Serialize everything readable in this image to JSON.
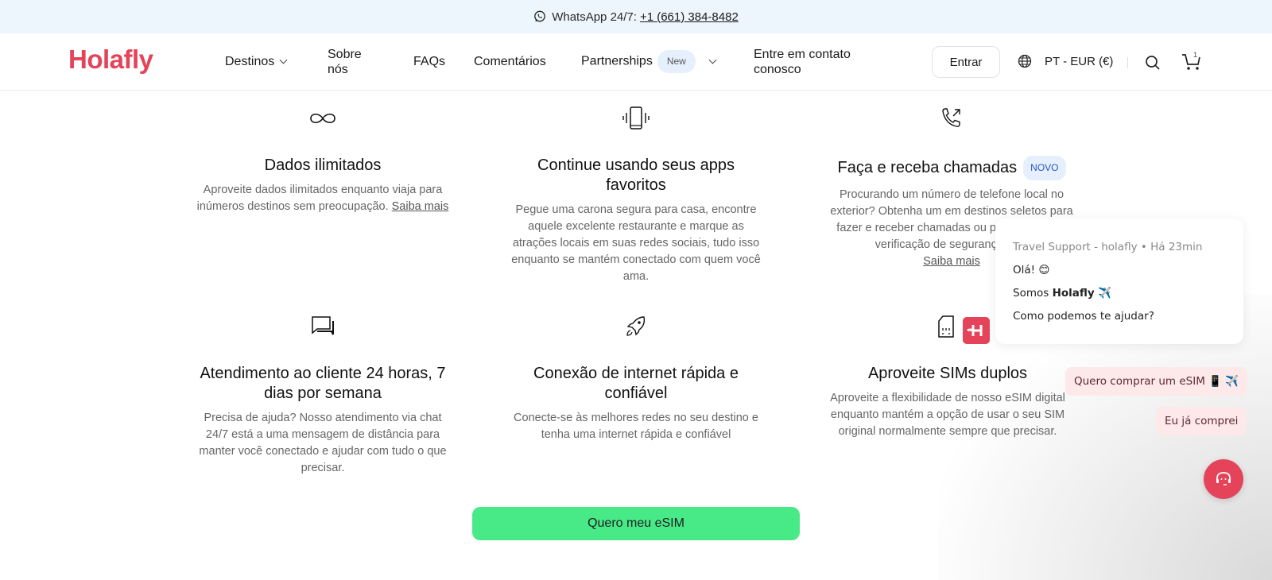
{
  "topbar": {
    "whatsapp_label": "WhatsApp 24/7:",
    "phone": "+1 (661) 384-8482",
    "icon": "whatsapp-icon"
  },
  "nav": {
    "logo": "Holafly",
    "items": [
      {
        "label": "Destinos",
        "has_dropdown": true
      },
      {
        "label": "Sobre nós"
      },
      {
        "label": "FAQs"
      },
      {
        "label": "Comentários"
      },
      {
        "label": "Partnerships",
        "badge": "New",
        "has_dropdown": true
      },
      {
        "label": "Entre em contato conosco"
      }
    ],
    "login_label": "Entrar",
    "locale_label": "PT - EUR (€)",
    "cart_count": "1",
    "brand_color": "#e5435a"
  },
  "features": [
    {
      "icon": "infinity-icon",
      "title": "Dados ilimitados",
      "text": "Aproveite dados ilimitados enquanto viaja para inúmeros destinos sem preocupação.",
      "link": "Saiba mais"
    },
    {
      "icon": "phone-vibrate-icon",
      "title": "Continue usando seus apps favoritos",
      "text": "Pegue uma carona segura para casa, encontre aquele excelente restaurante e marque as atrações locais em suas redes sociais, tudo isso enquanto se mantém conectado com quem você ama."
    },
    {
      "icon": "phone-call-icon",
      "title": "Faça e receba chamadas",
      "badge": "NOVO",
      "text": "Procurando um número de telefone local no exterior? Obtenha um em destinos seletos para fazer e receber chamadas ou para pontos de verificação de segurança com",
      "link": "Saiba mais"
    },
    {
      "icon": "chat-bubbles-icon",
      "title": "Atendimento ao cliente 24 horas, 7 dias por semana",
      "text": "Precisa de ajuda? Nosso atendimento via chat 24/7 está a uma mensagem de distância para manter você conectado e ajudar com tudo o que precisar."
    },
    {
      "icon": "rocket-icon",
      "title": "Conexão de internet rápida e confiável",
      "text": "Conecte-se às melhores redes no seu destino e tenha uma internet rápida e confiável"
    },
    {
      "icon": "sim-card-icon",
      "title": "Aproveite SIMs duplos",
      "text": "Aproveite a flexibilidade de nosso eSIM digital enquanto mantém a opção de usar o seu SIM original normalmente sempre que precisar."
    }
  ],
  "cta": {
    "label": "Quero meu eSIM",
    "color": "#48e987"
  },
  "chat": {
    "meta": "Travel Support - holafly • Há 23min",
    "messages": [
      "Olá! 😊",
      "Somos",
      "Holafly",
      "✈️",
      "Como podemos te ajudar?"
    ],
    "avatar_letter": "H",
    "quick_replies": [
      "Quero comprar um eSIM 📱 ✈️",
      "Eu já comprei"
    ]
  }
}
